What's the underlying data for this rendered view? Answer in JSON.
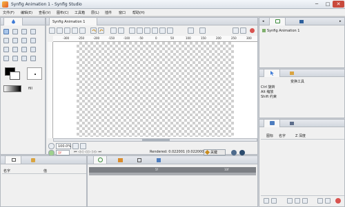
{
  "window": {
    "title": "Synfig Animation 1 - Synfig Studio",
    "min": "─",
    "max": "□",
    "close": "✕"
  },
  "menu": [
    "文件(F)",
    "编辑(E)",
    "查看(V)",
    "图布(C)",
    "工具箱",
    "层(L)",
    "插件",
    "窗口",
    "帮助(H)"
  ],
  "canvas_tab": {
    "label": "Synfig Animation 1"
  },
  "ruler": {
    "ticks": [
      "-300",
      "-250",
      "-200",
      "-150",
      "-100",
      "-50",
      "0",
      "50",
      "100",
      "150",
      "200",
      "250",
      "300"
    ]
  },
  "toolbox": {
    "fill_label": "fill"
  },
  "zoom": {
    "value": "100.0%"
  },
  "time": {
    "current": "0f",
    "render_status": "Rendered: 0.022001 (0.022000) sec",
    "keyframe_mode": "关键"
  },
  "layers_panel": {
    "header_name": "名字",
    "header_value": "值"
  },
  "timeline": {
    "marker_a": "5f",
    "marker_b": "10f"
  },
  "canvas_browser": {
    "item": "Synfig Animation 1"
  },
  "tool_options": {
    "title": "变换工具",
    "lines": [
      "Ctrl 旋转",
      "Alt 缩放",
      "Shift 约束"
    ]
  },
  "layers_list": {
    "col_icon": "图标",
    "col_name": "名字",
    "col_depth": "Z 深度"
  },
  "colors": {
    "accent": "#3d7ad6",
    "title_bg": "#e7ecf2",
    "record": "#d9534f"
  }
}
